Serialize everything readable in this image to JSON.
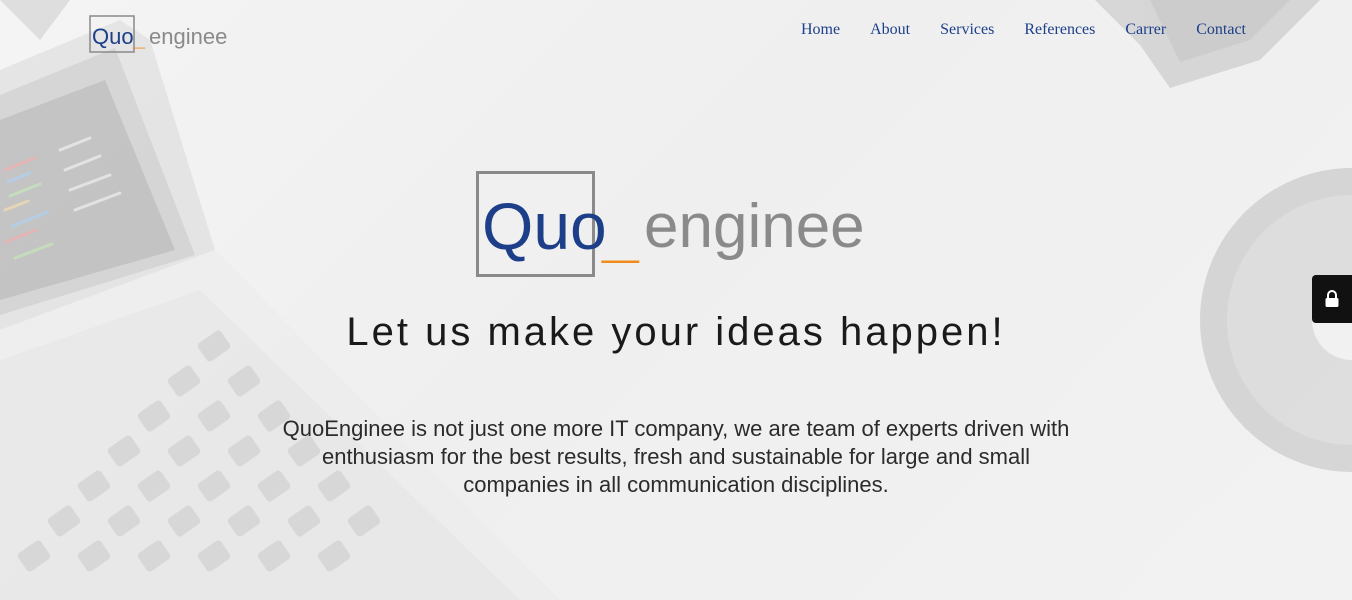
{
  "brand": {
    "name_part1": "Quo",
    "name_separator": "_",
    "name_part2": "enginee",
    "color_primary": "#1d3f8a",
    "color_accent": "#f08c1e",
    "color_gray": "#8a8a8a"
  },
  "nav": {
    "items": [
      {
        "label": "Home"
      },
      {
        "label": "About"
      },
      {
        "label": "Services"
      },
      {
        "label": "References"
      },
      {
        "label": "Carrer"
      },
      {
        "label": "Contact"
      }
    ]
  },
  "hero": {
    "tagline": "Let us make your ideas happen!",
    "intro": "QuoEnginee is not just one more IT company, we are team of experts driven with enthusiasm for the best results, fresh and sustainable for large and small companies in all communication disciplines."
  },
  "side_button": {
    "icon": "lock-icon"
  }
}
